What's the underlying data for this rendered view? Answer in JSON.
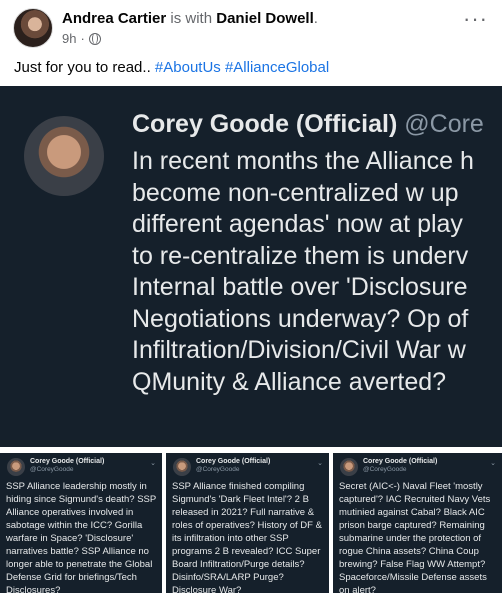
{
  "post": {
    "author": "Andrea Cartier",
    "with_text": "is with",
    "tagged": "Daniel Dowell",
    "tagged_suffix": ".",
    "time": "9h",
    "dot": "·",
    "more": "···",
    "caption_text": "Just for you to read.. ",
    "hashtags": [
      "#AboutUs",
      "#AllianceGlobal"
    ]
  },
  "main_tweet": {
    "name": "Corey Goode (Official)",
    "handle": "@Core",
    "lines": [
      "In recent months the Alliance h",
      "become non-centralized w up",
      "different agendas' now at play",
      "to re-centralize them is underv",
      "Internal battle over 'Disclosure",
      "Negotiations underway? Op of",
      "Infiltration/Division/Civil War w",
      "QMunity & Alliance averted?"
    ]
  },
  "mini_tweets": [
    {
      "name": "Corey Goode (Official)",
      "handle": "@CoreyGoode",
      "caret": "⌄",
      "text": "SSP Alliance leadership mostly in hiding since Sigmund's death? SSP Alliance operatives involved in sabotage within the ICC? Gorilla warfare in Space? 'Disclosure' narratives battle? SSP Alliance no longer able to penetrate the Global Defense Grid for briefings/Tech Disclosures?"
    },
    {
      "name": "Corey Goode (Official)",
      "handle": "@CoreyGoode",
      "caret": "⌄",
      "text": "SSP Alliance finished compiling Sigmund's 'Dark Fleet Intel'? 2 B released in 2021? Full narrative & roles of operatives? History of DF & its infiltration into other SSP programs 2 B revealed? ICC Super Board Infiltration/Purge details? Disinfo/SRA/LARP Purge? Disclosure War?"
    },
    {
      "name": "Corey Goode (Official)",
      "handle": "@CoreyGoode",
      "caret": "⌄",
      "text": "Secret (AIC<-) Naval Fleet 'mostly captured'? IAC Recruited Navy Vets mutinied against Cabal? Black AIC prison barge captured? Remaining submarine under the protection of rogue China assets? China Coup brewing? False Flag WW Attempt? Spaceforce/Missile Defense assets on alert?"
    }
  ]
}
